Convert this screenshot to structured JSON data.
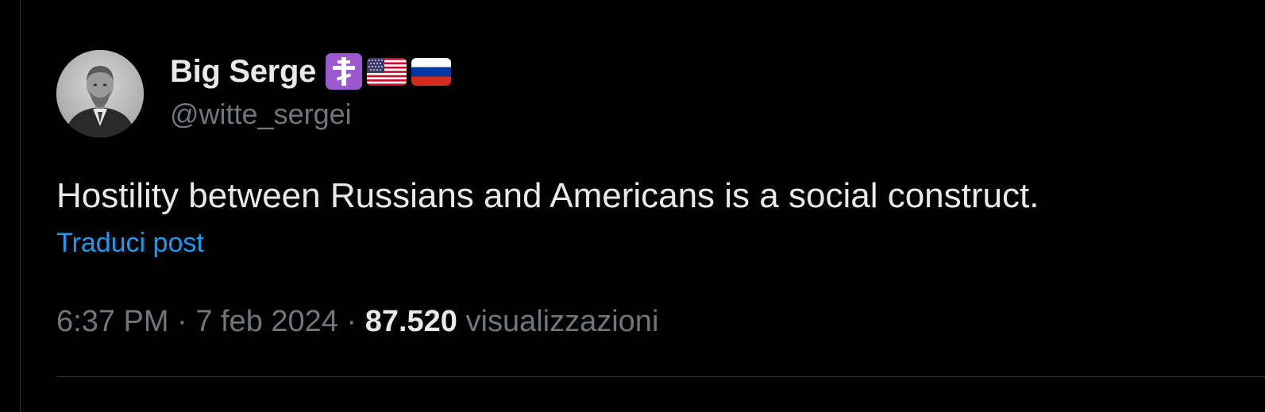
{
  "author": {
    "display_name": "Big Serge",
    "handle": "@witte_sergei",
    "badges": [
      "orthodox-cross-icon",
      "us-flag-icon",
      "russia-flag-icon"
    ]
  },
  "post": {
    "text": "Hostility between Russians and Americans is a social construct.",
    "translate_label": "Traduci post",
    "time": "6:37 PM",
    "separator": "·",
    "date": "7 feb 2024",
    "views_count": "87.520",
    "views_label": "visualizzazioni"
  },
  "colors": {
    "background": "#000000",
    "primary_text": "#e7e9ea",
    "secondary_text": "#71767b",
    "link": "#1d9bf0",
    "divider": "#2f3336",
    "cross_badge": "#9b59d0"
  }
}
